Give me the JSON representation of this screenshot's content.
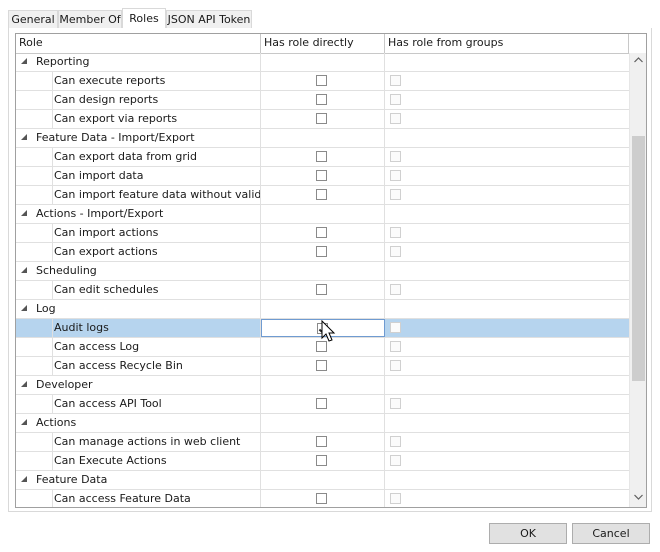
{
  "tabs": [
    {
      "label": "General",
      "active": false
    },
    {
      "label": "Member Of",
      "active": false
    },
    {
      "label": "Roles",
      "active": true
    },
    {
      "label": "JSON API Token",
      "active": false
    }
  ],
  "columns": [
    "Role",
    "Has role directly",
    "Has role from groups"
  ],
  "rows": [
    {
      "type": "category",
      "label": "Reporting"
    },
    {
      "type": "item",
      "label": "Can execute reports",
      "direct": false,
      "groups": false
    },
    {
      "type": "item",
      "label": "Can design reports",
      "direct": false,
      "groups": false
    },
    {
      "type": "item",
      "label": "Can export via reports",
      "direct": false,
      "groups": false
    },
    {
      "type": "category",
      "label": "Feature Data - Import/Export"
    },
    {
      "type": "item",
      "label": "Can export data from grid",
      "direct": false,
      "groups": false
    },
    {
      "type": "item",
      "label": "Can import data",
      "direct": false,
      "groups": false
    },
    {
      "type": "item",
      "label": "Can import feature data without validatior",
      "direct": false,
      "groups": false
    },
    {
      "type": "category",
      "label": "Actions - Import/Export"
    },
    {
      "type": "item",
      "label": "Can import actions",
      "direct": false,
      "groups": false
    },
    {
      "type": "item",
      "label": "Can export actions",
      "direct": false,
      "groups": false
    },
    {
      "type": "category",
      "label": "Scheduling"
    },
    {
      "type": "item",
      "label": "Can edit schedules",
      "direct": false,
      "groups": false
    },
    {
      "type": "category",
      "label": "Log"
    },
    {
      "type": "item",
      "label": "Audit logs",
      "direct": true,
      "groups": false,
      "selected": true
    },
    {
      "type": "item",
      "label": "Can access Log",
      "direct": false,
      "groups": false
    },
    {
      "type": "item",
      "label": "Can access Recycle Bin",
      "direct": false,
      "groups": false
    },
    {
      "type": "category",
      "label": "Developer"
    },
    {
      "type": "item",
      "label": "Can access API Tool",
      "direct": false,
      "groups": false
    },
    {
      "type": "category",
      "label": "Actions"
    },
    {
      "type": "item",
      "label": "Can manage actions in web client",
      "direct": false,
      "groups": false
    },
    {
      "type": "item",
      "label": "Can Execute Actions",
      "direct": false,
      "groups": false
    },
    {
      "type": "category",
      "label": "Feature Data"
    },
    {
      "type": "item",
      "label": "Can access Feature Data",
      "direct": false,
      "groups": false
    }
  ],
  "buttons": {
    "ok": "OK",
    "cancel": "Cancel"
  },
  "icons": {
    "expander": "triangle-expanded-icon",
    "scroll_up": "chevron-up-icon",
    "scroll_down": "chevron-down-icon",
    "cursor": "mouse-pointer-icon"
  },
  "colors": {
    "selection": "#b6d4ee",
    "grid_line": "#e0e0e0"
  }
}
